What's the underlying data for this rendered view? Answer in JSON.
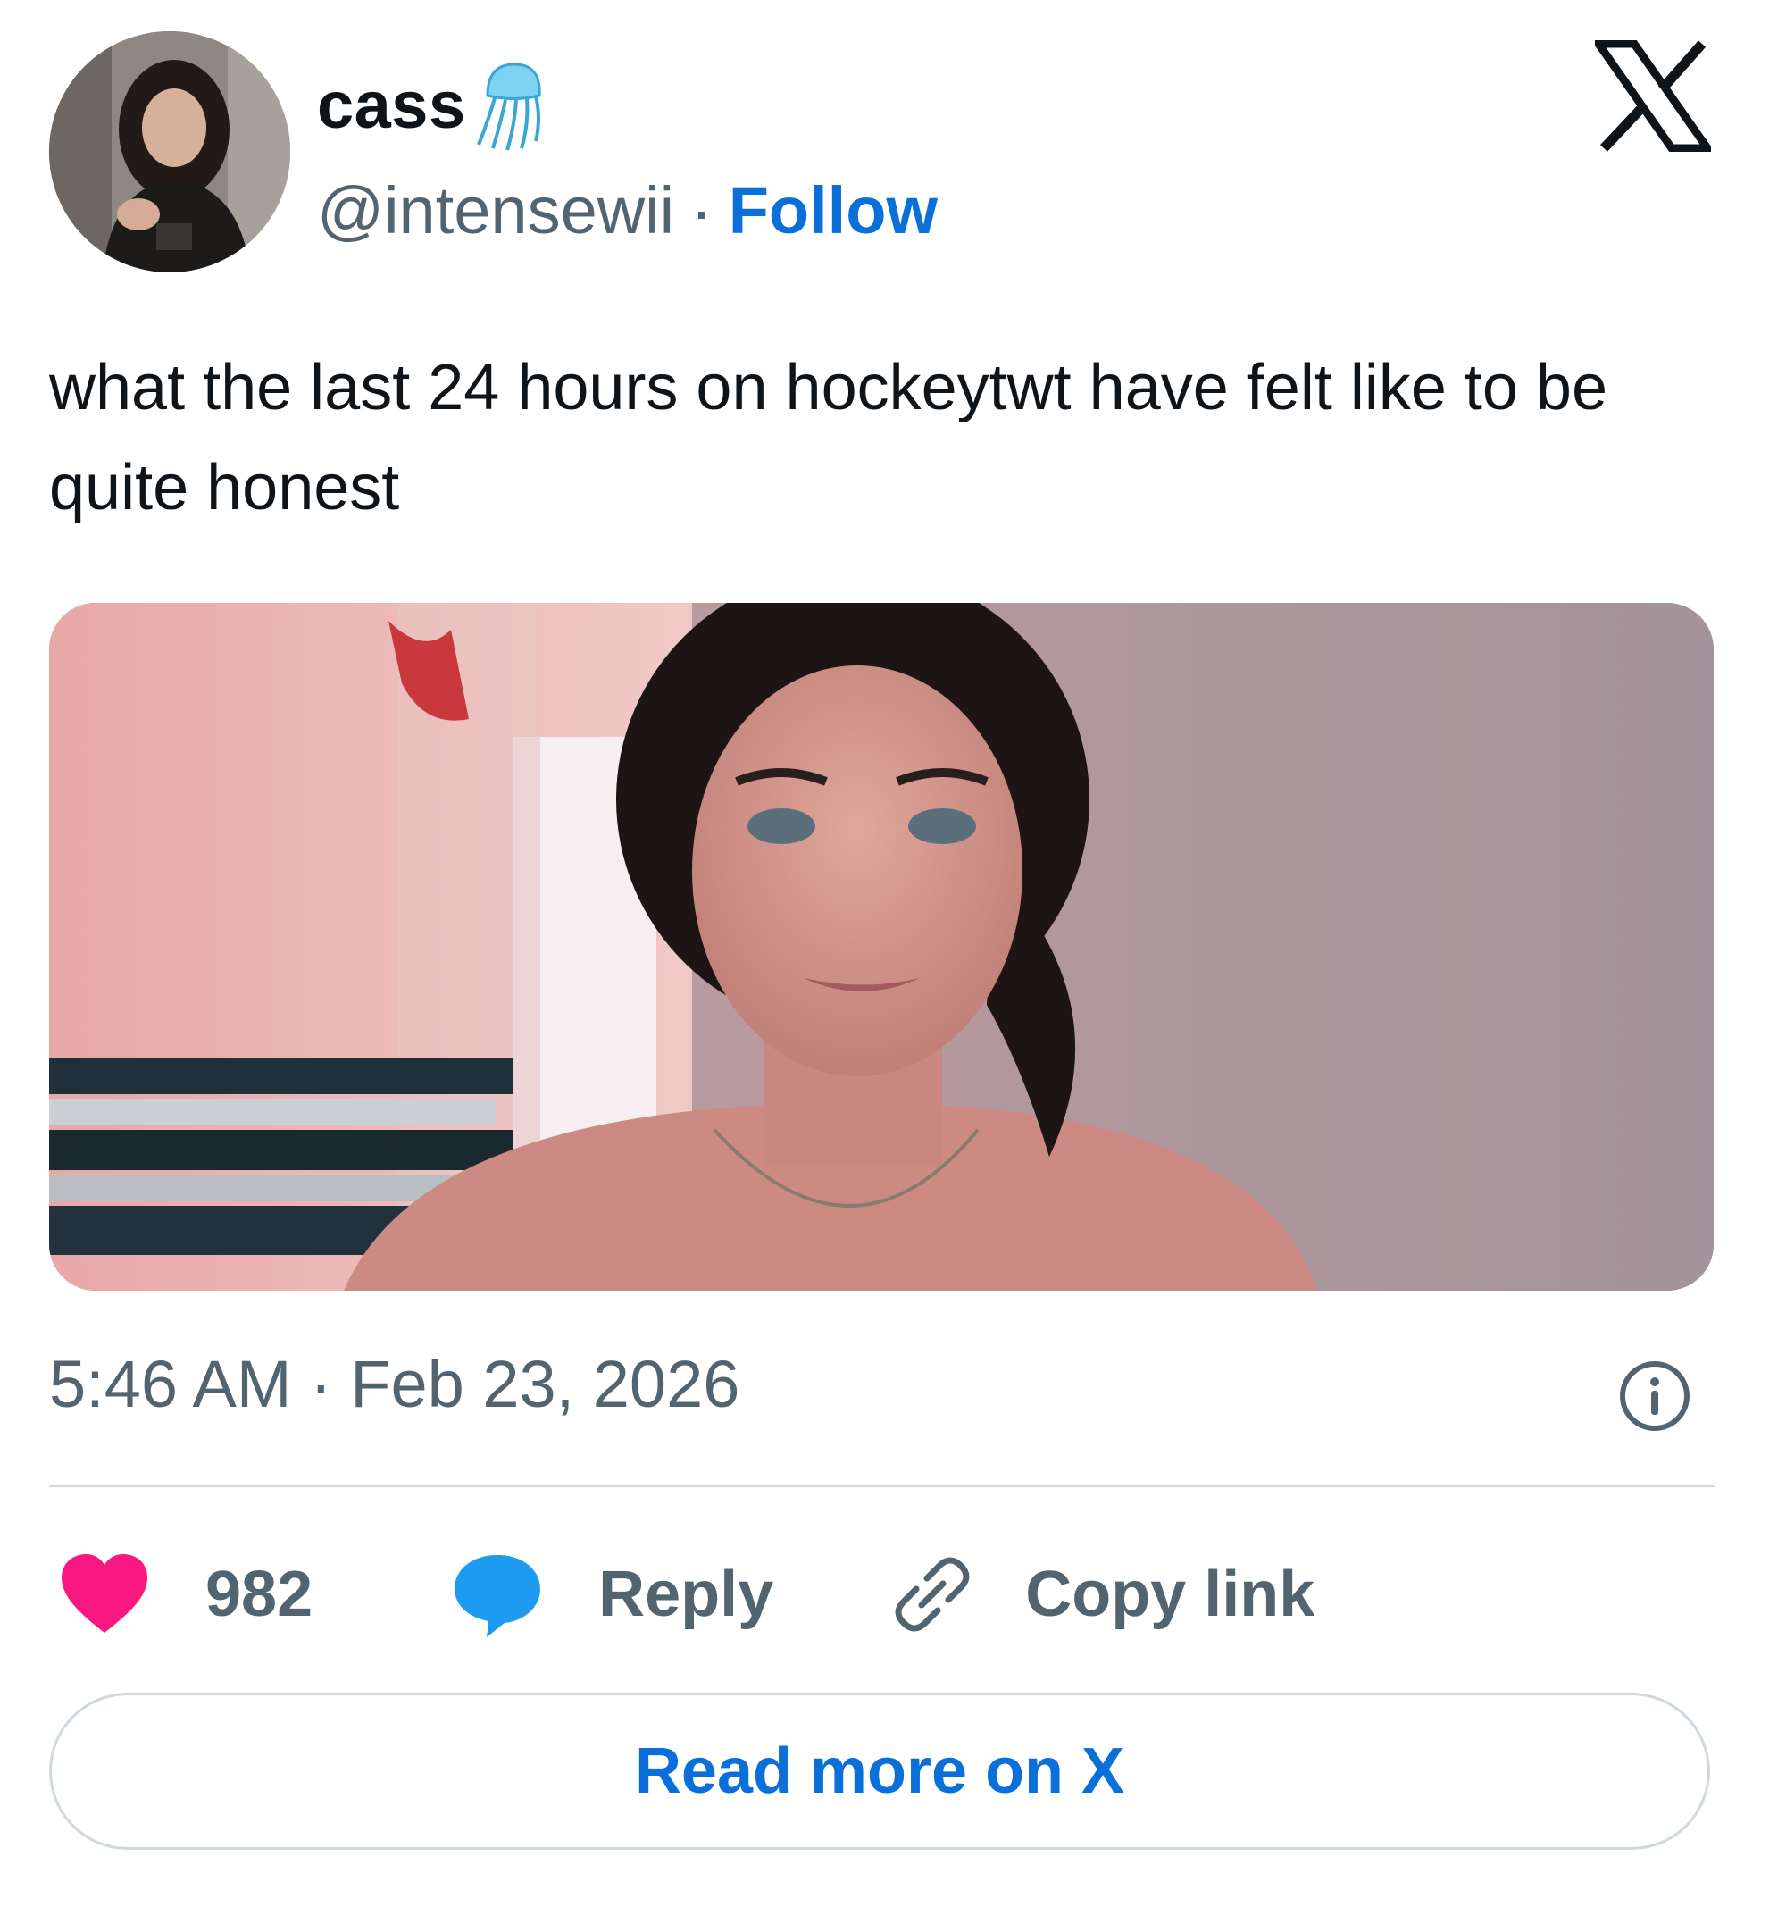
{
  "author": {
    "display_name": "cass",
    "name_emoji_icon": "jellyfish-icon",
    "handle": "@intensewii",
    "separator": "·",
    "follow_label": "Follow"
  },
  "brand": {
    "logo_icon": "x-logo-icon"
  },
  "tweet": {
    "text": "what the last 24 hours on hockeytwt have felt like to be quite honest",
    "media_icon": "embedded-video-thumbnail",
    "timestamp": "5:46 AM · Feb 23, 2026"
  },
  "actions": {
    "like_count": "982",
    "reply_label": "Reply",
    "copy_link_label": "Copy link"
  },
  "footer": {
    "read_more_label": "Read more on X"
  },
  "colors": {
    "accent": "#0b6fd9",
    "muted_text": "#536471",
    "heart": "#f91880",
    "reply_bubble": "#1d9bf0",
    "divider": "#cfd9de"
  }
}
